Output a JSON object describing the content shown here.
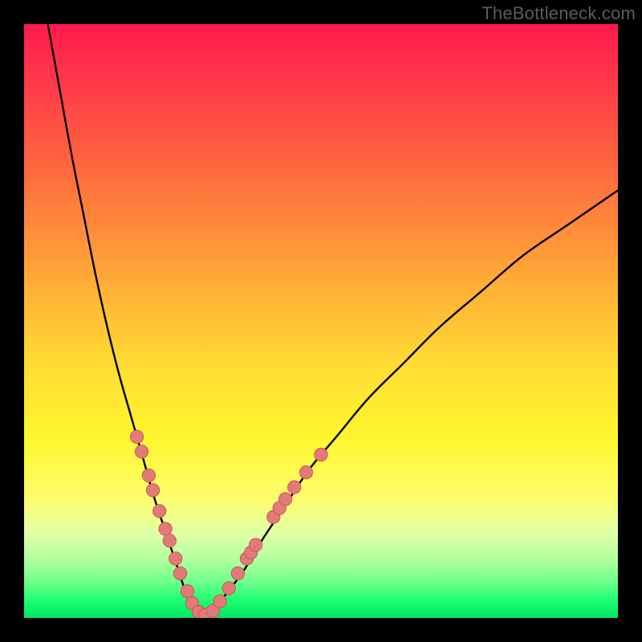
{
  "watermark": "TheBottleneck.com",
  "colors": {
    "frame": "#000000",
    "curve": "#000000",
    "marker_fill": "#e27a7a",
    "marker_stroke": "#c85858",
    "gradient_stops": [
      {
        "offset": 0.0,
        "color": "#ff1a4d"
      },
      {
        "offset": 0.1,
        "color": "#ff3a4a"
      },
      {
        "offset": 0.22,
        "color": "#ff6140"
      },
      {
        "offset": 0.34,
        "color": "#ff8a3a"
      },
      {
        "offset": 0.46,
        "color": "#ffb536"
      },
      {
        "offset": 0.58,
        "color": "#ffdd33"
      },
      {
        "offset": 0.7,
        "color": "#fff72e"
      },
      {
        "offset": 0.8,
        "color": "#fdfd6e"
      },
      {
        "offset": 0.86,
        "color": "#dfffa8"
      },
      {
        "offset": 0.9,
        "color": "#b4ff9e"
      },
      {
        "offset": 0.94,
        "color": "#6dff8a"
      },
      {
        "offset": 0.97,
        "color": "#1cff70"
      },
      {
        "offset": 1.0,
        "color": "#00e663"
      }
    ]
  },
  "chart_data": {
    "type": "line",
    "title": "",
    "xlabel": "",
    "ylabel": "",
    "x_range": [
      0,
      100
    ],
    "y_range": [
      0,
      100
    ],
    "series": [
      {
        "name": "left-branch",
        "x": [
          4,
          6,
          8,
          10,
          12,
          14,
          16,
          18,
          20,
          22,
          24,
          26,
          27,
          28,
          29,
          30
        ],
        "y": [
          100,
          89,
          78,
          68,
          58,
          49,
          41,
          34,
          27,
          20,
          14,
          8,
          5,
          3,
          1.5,
          0.5
        ]
      },
      {
        "name": "right-branch",
        "x": [
          30,
          32,
          34,
          37,
          40,
          44,
          48,
          53,
          58,
          64,
          70,
          77,
          84,
          92,
          100
        ],
        "y": [
          0.5,
          1.5,
          4,
          8,
          13,
          19,
          25,
          31,
          37,
          43,
          49,
          55,
          61,
          66.5,
          72
        ]
      }
    ],
    "markers": {
      "name": "scatter-points",
      "points": [
        {
          "x": 19.0,
          "y": 30.5
        },
        {
          "x": 19.8,
          "y": 28.0
        },
        {
          "x": 21.0,
          "y": 24.0
        },
        {
          "x": 21.7,
          "y": 21.5
        },
        {
          "x": 22.8,
          "y": 18.0
        },
        {
          "x": 23.8,
          "y": 15.0
        },
        {
          "x": 24.5,
          "y": 13.0
        },
        {
          "x": 25.5,
          "y": 10.0
        },
        {
          "x": 26.3,
          "y": 7.5
        },
        {
          "x": 27.5,
          "y": 4.5
        },
        {
          "x": 28.3,
          "y": 2.5
        },
        {
          "x": 29.4,
          "y": 1.0
        },
        {
          "x": 30.5,
          "y": 0.5
        },
        {
          "x": 31.8,
          "y": 1.2
        },
        {
          "x": 33.0,
          "y": 2.8
        },
        {
          "x": 34.5,
          "y": 5.0
        },
        {
          "x": 36.0,
          "y": 7.5
        },
        {
          "x": 37.5,
          "y": 10.0
        },
        {
          "x": 38.2,
          "y": 11.0
        },
        {
          "x": 39.0,
          "y": 12.3
        },
        {
          "x": 42.0,
          "y": 17.0
        },
        {
          "x": 43.0,
          "y": 18.5
        },
        {
          "x": 44.0,
          "y": 20.0
        },
        {
          "x": 45.5,
          "y": 22.0
        },
        {
          "x": 47.5,
          "y": 24.5
        },
        {
          "x": 50.0,
          "y": 27.5
        }
      ],
      "r": 1.1
    }
  }
}
